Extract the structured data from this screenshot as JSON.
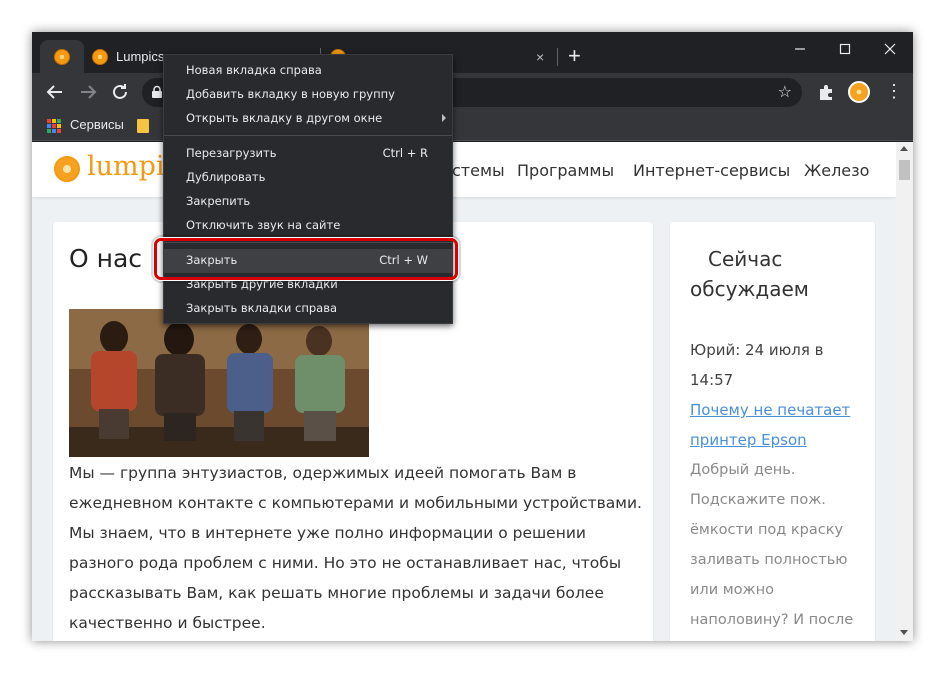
{
  "browser": {
    "tabs": [
      {
        "title": "Lumpics.",
        "close": "×"
      },
      {
        "title": "",
        "close": "×"
      }
    ],
    "new_tab": "+",
    "window_controls": {
      "minimize": "—",
      "maximize": "☐",
      "close": "✕"
    },
    "menu_dots": "⋮",
    "star": "☆",
    "bookmarks": [
      {
        "label": "Сервисы"
      }
    ]
  },
  "context_menu": {
    "items": [
      {
        "label": "Новая вкладка справа",
        "shortcut": ""
      },
      {
        "label": "Добавить вкладку в новую группу",
        "shortcut": ""
      },
      {
        "label": "Открыть вкладку в другом окне",
        "shortcut": "",
        "submenu": true
      },
      {
        "label": "Перезагрузить",
        "shortcut": "Ctrl + R"
      },
      {
        "label": "Дублировать",
        "shortcut": ""
      },
      {
        "label": "Закрепить",
        "shortcut": ""
      },
      {
        "label": "Отключить звук на сайте",
        "shortcut": ""
      },
      {
        "label": "Закрыть",
        "shortcut": "Ctrl + W",
        "highlighted": true
      },
      {
        "label": "Закрыть другие вкладки",
        "shortcut": ""
      },
      {
        "label": "Закрыть вкладки справа",
        "shortcut": ""
      }
    ],
    "highlight_color": "#d90000"
  },
  "site": {
    "logo_text": "lumpics",
    "nav": [
      "стемы",
      "Программы",
      "Интернет-сервисы",
      "Железо"
    ],
    "main": {
      "title": "О нас",
      "text": "Мы — группа энтузиастов, одержимых идеей помогать Вам в ежедневном контакте с компьютерами и мобильными устройствами. Мы знаем, что в интернете уже полно информации о решении разного рода проблем с ними. Но это не останавливает нас, чтобы рассказывать Вам, как решать многие проблемы и задачи более качественно и быстрее."
    },
    "sidebar": {
      "title": "Сейчас обсуждаем",
      "meta": "Юрий: 24 июля в 14:57",
      "link": "Почему не печатает принтер Epson",
      "comment": "Добрый день. Подскажите пож. ёмкости под краску заливать полностью или можно наполовину? И после"
    }
  },
  "colors": {
    "chrome_dark": "#202124",
    "toolbar": "#35363a",
    "menu_bg": "#292a2d",
    "brand_orange": "#f29a12",
    "link_blue": "#4a90d9"
  }
}
